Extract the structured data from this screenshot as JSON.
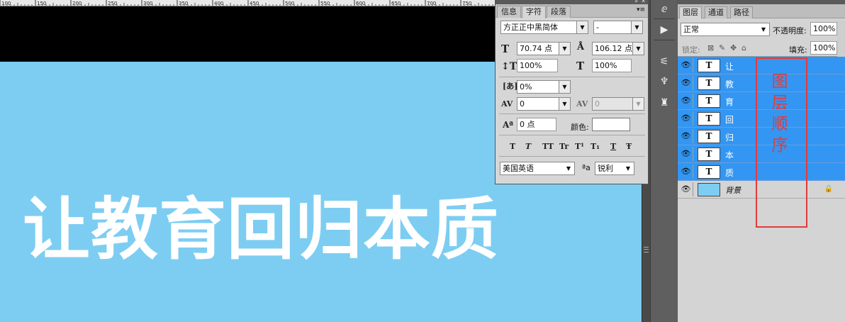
{
  "ruler": {
    "ticks": [
      "100",
      "150",
      "200",
      "250",
      "300",
      "350",
      "400",
      "450",
      "500",
      "550",
      "600",
      "650",
      "700",
      "750"
    ]
  },
  "canvas": {
    "text": "让教育回归本质",
    "background": "#7dcdf2"
  },
  "character_panel": {
    "tabs": [
      "信息",
      "字符",
      "段落"
    ],
    "active_tab": "字符",
    "font_family": "方正正中黑简体",
    "font_style": "-",
    "font_size": "70.74 点",
    "leading": "106.12 点",
    "vertical_scale": "100%",
    "horizontal_scale": "100%",
    "tsume": "0%",
    "kerning": "0",
    "tracking": "0",
    "baseline_shift": "0 点",
    "color_label": "颜色:",
    "color_value": "#ffffff",
    "type_styles": [
      "T",
      "T",
      "TT",
      "Tr",
      "T¹",
      "T₁",
      "T",
      "Ŧ"
    ],
    "language": "美国英语",
    "antialias_icon": "ªa",
    "antialias": "锐利"
  },
  "layers_panel": {
    "tabs": [
      "图层",
      "通道",
      "路径"
    ],
    "active_tab": "图层",
    "blend_mode": "正常",
    "opacity_label": "不透明度:",
    "opacity": "100%",
    "lock_label": "锁定:",
    "fill_label": "填充:",
    "fill": "100%",
    "layers": [
      {
        "name": "让",
        "thumb": "T",
        "selected": true
      },
      {
        "name": "教",
        "thumb": "T",
        "selected": true
      },
      {
        "name": "育",
        "thumb": "T",
        "selected": true
      },
      {
        "name": "回",
        "thumb": "T",
        "selected": true
      },
      {
        "name": "归",
        "thumb": "T",
        "selected": true
      },
      {
        "name": "本",
        "thumb": "T",
        "selected": true
      },
      {
        "name": "质",
        "thumb": "T",
        "selected": true
      }
    ],
    "background_layer": {
      "name": "背景"
    },
    "selection_color": "#3396f2"
  },
  "annotation": {
    "text": "图层顺序",
    "color": "#e23b3b"
  }
}
